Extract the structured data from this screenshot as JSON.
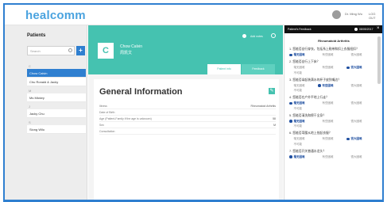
{
  "app": {
    "logo": "healcomm",
    "user_name": "Dr. Ming Wu",
    "logout": "LOG OUT"
  },
  "sidebar": {
    "title": "Patients",
    "search_placeholder": "Search",
    "add_label": "+",
    "groups": [
      {
        "letter": "C",
        "items": [
          {
            "name": "Chow Calvin",
            "active": true
          },
          {
            "name": "Chu Ronald & Jacky",
            "active": false
          }
        ]
      },
      {
        "letter": "M",
        "items": [
          {
            "name": "Ms Mickey",
            "active": false
          }
        ]
      },
      {
        "letter": "J",
        "items": [
          {
            "name": "Jacky Chu",
            "active": false
          }
        ]
      },
      {
        "letter": "S",
        "items": [
          {
            "name": "Siong Wilu",
            "active": false
          }
        ]
      }
    ]
  },
  "patient": {
    "initial": "C",
    "name": "Chow Calvin",
    "name_cn": "周凯文",
    "header_link": "Add notes",
    "tabs": [
      {
        "label": "Patient info"
      },
      {
        "label": "Feedback"
      }
    ]
  },
  "info": {
    "title": "General Information",
    "edit_icon": "edit-icon",
    "rows": [
      {
        "label": "Illness",
        "value": "Rheumatoid Arthritis"
      },
      {
        "label": "Date of Birth",
        "value": ""
      },
      {
        "label": "Age (Patient-Family if the age is unknown)",
        "value": "58"
      },
      {
        "label": "Sex",
        "value": "M"
      },
      {
        "label": "Consultation",
        "value": ""
      }
    ]
  },
  "feedback": {
    "title": "Patient's Feedback",
    "date": "08/05/2017",
    "close": "×",
    "section": "Rheumatoid Arthritis",
    "questions": [
      {
        "text": "1. 您能否自行穿衣，包括系上鞋带和扣上衣服纽扣？",
        "options": [
          "毫无困难",
          "有些困难",
          "很大困难"
        ],
        "selected": 0
      },
      {
        "text": "2. 您能否自行上下床？",
        "options": [
          "毫无困难",
          "有些困难",
          "很大困难",
          "不可能"
        ],
        "selected": 2
      },
      {
        "text": "3. 您能否拿起装满水的杯子放到嘴边？",
        "options": [
          "毫无困难",
          "有些困难",
          "很大困难",
          "不可能"
        ],
        "selected": 1
      },
      {
        "text": "4. 您能否在户外平地上行走？",
        "options": [
          "毫无困难",
          "有些困难",
          "很大困难",
          "不可能"
        ],
        "selected": 0
      },
      {
        "text": "5. 您能否清洗和擦干全身？",
        "options": [
          "毫无困难",
          "有些困难",
          "很大困难",
          "不可能"
        ],
        "selected": 0
      },
      {
        "text": "6. 您能否弯腰从地上拾起衣服？",
        "options": [
          "毫无困难",
          "有些困难",
          "很大困难",
          "不可能"
        ],
        "selected": 2
      },
      {
        "text": "7. 您能否开关普通水龙头？",
        "options": [
          "毫无困难",
          "有些困难",
          "很大困难"
        ],
        "selected": 0
      }
    ]
  }
}
